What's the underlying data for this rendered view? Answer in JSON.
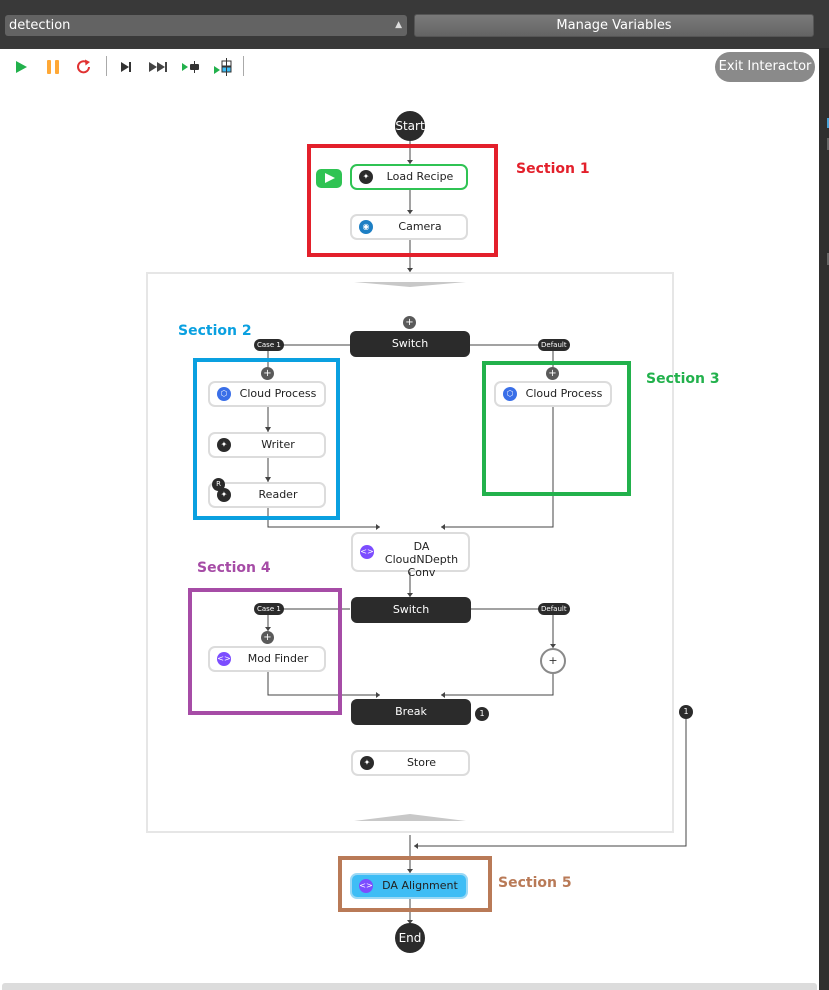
{
  "header": {
    "workflow_select": {
      "value": "detection"
    },
    "manage_variables_label": "Manage Variables"
  },
  "toolbar": {
    "buttons": [
      {
        "name": "run",
        "icon": "play-icon"
      },
      {
        "name": "pause",
        "icon": "pause-icon"
      },
      {
        "name": "restart",
        "icon": "restart-icon"
      },
      {
        "name": "step",
        "icon": "step-icon"
      },
      {
        "name": "fast-forward",
        "icon": "fast-forward-icon"
      },
      {
        "name": "run-to-node",
        "icon": "run-to-node-icon"
      },
      {
        "name": "run-to-selected",
        "icon": "run-to-selected-icon"
      }
    ],
    "exit_label": "Exit Interactor"
  },
  "flow": {
    "start_label": "Start",
    "end_label": "End",
    "nodes": {
      "load_recipe": "Load Recipe",
      "camera": "Camera",
      "switch1": "Switch",
      "case1_a": "Case 1",
      "default_a": "Default",
      "cloud_process_1": "Cloud Process",
      "writer": "Writer",
      "reader": "Reader",
      "reader_badge": "R",
      "cloud_process_2": "Cloud Process",
      "da_cloud_conv_line1": "DA CloudNDepth",
      "da_cloud_conv_line2": "Conv",
      "switch2": "Switch",
      "case1_b": "Case 1",
      "default_b": "Default",
      "mod_finder": "Mod Finder",
      "break": "Break",
      "break_badge": "1",
      "outer_badge": "1",
      "store": "Store",
      "da_alignment": "DA Alignment",
      "plus": "+"
    }
  },
  "sections": [
    {
      "label": "Section 1",
      "color": "#e3202b"
    },
    {
      "label": "Section 2",
      "color": "#0aa0e0"
    },
    {
      "label": "Section 3",
      "color": "#22b14c"
    },
    {
      "label": "Section 4",
      "color": "#a64ca6"
    },
    {
      "label": "Section 5",
      "color": "#b97a57"
    }
  ]
}
